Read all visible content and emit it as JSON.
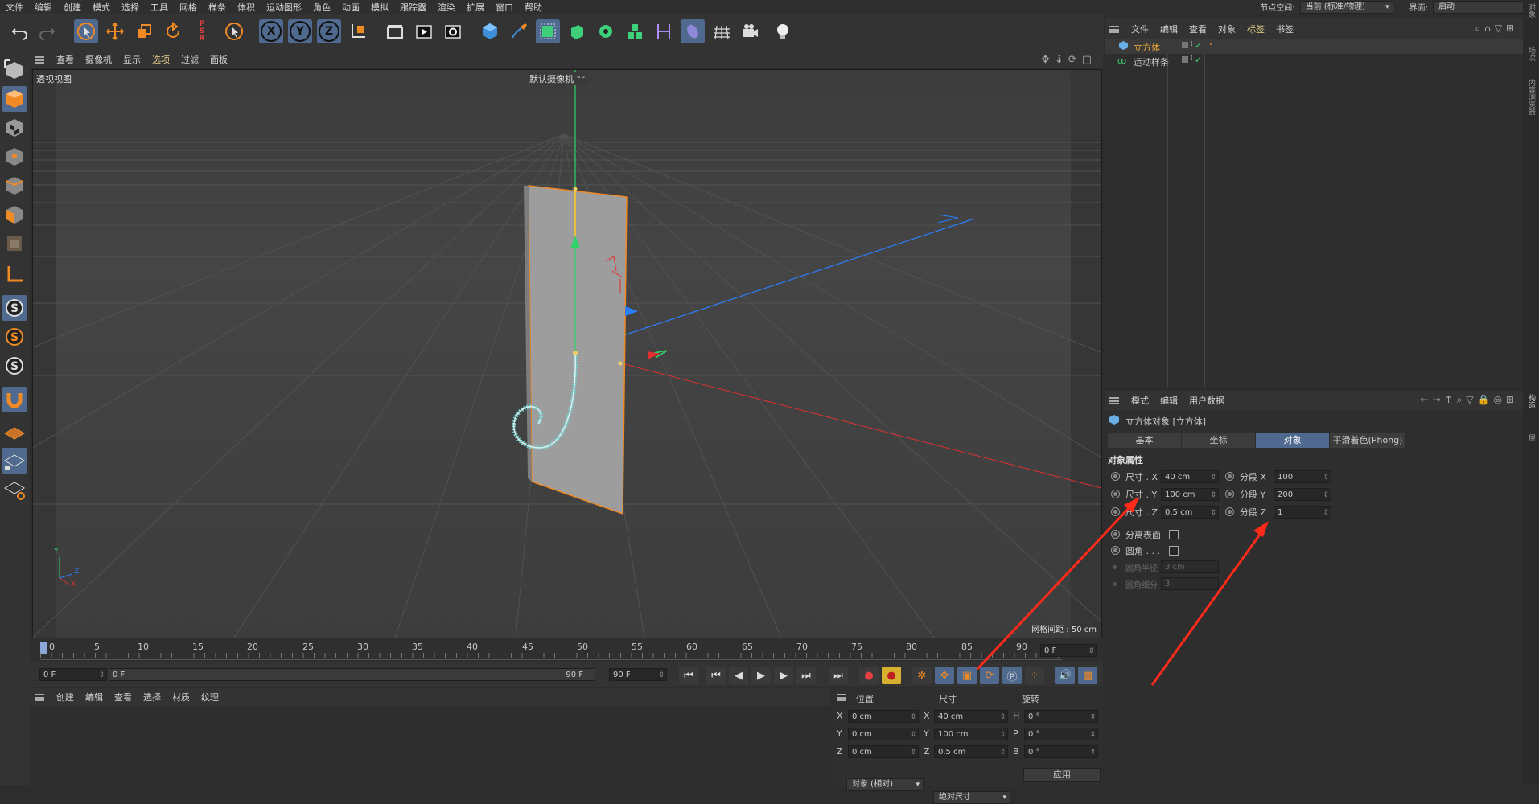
{
  "menubar": {
    "items": [
      "文件",
      "编辑",
      "创建",
      "模式",
      "选择",
      "工具",
      "网格",
      "样条",
      "体积",
      "运动图形",
      "角色",
      "动画",
      "模拟",
      "跟踪器",
      "渲染",
      "扩展",
      "窗口",
      "帮助"
    ],
    "node_space_label": "节点空间:",
    "node_space_value": "当前 (标准/物理)",
    "layout_label": "界面:",
    "layout_value": "启动"
  },
  "viewport": {
    "menu": [
      "查看",
      "摄像机",
      "显示",
      "选项",
      "过滤",
      "面板"
    ],
    "view_name": "透视视图",
    "camera": "默认摄像机",
    "camera_icon": "°°",
    "grid_spacing": "网格间距 : 50 cm",
    "axis_y": "Y",
    "axis_z": "Z",
    "axis_x": "X"
  },
  "timeline": {
    "ticks": [
      "0",
      "5",
      "10",
      "15",
      "20",
      "25",
      "30",
      "35",
      "40",
      "45",
      "50",
      "55",
      "60",
      "65",
      "70",
      "75",
      "80",
      "85",
      "90"
    ],
    "frame_field": "0 F"
  },
  "transport": {
    "start": "0 F",
    "range_start": "0 F",
    "range_end": "90 F",
    "end": "90 F"
  },
  "material": {
    "menu": [
      "创建",
      "编辑",
      "查看",
      "选择",
      "材质",
      "纹理"
    ]
  },
  "coords": {
    "headers": {
      "position": "位置",
      "size": "尺寸",
      "rotation": "旋转"
    },
    "rows": [
      {
        "axis": "X",
        "pos": "0 cm",
        "saxis": "X",
        "size": "40 cm",
        "raxis": "H",
        "rot": "0 °"
      },
      {
        "axis": "Y",
        "pos": "0 cm",
        "saxis": "Y",
        "size": "100 cm",
        "raxis": "P",
        "rot": "0 °"
      },
      {
        "axis": "Z",
        "pos": "0 cm",
        "saxis": "Z",
        "size": "0.5 cm",
        "raxis": "B",
        "rot": "0 °"
      }
    ],
    "mode": "对象 (相对)",
    "size_mode": "绝对尺寸",
    "apply": "应用"
  },
  "objects": {
    "menu": [
      "文件",
      "编辑",
      "查看",
      "对象",
      "标签",
      "书签"
    ],
    "items": [
      {
        "name": "立方体",
        "color": "#e8a93a"
      },
      {
        "name": "运动样条",
        "color": "#c8c8c8"
      }
    ]
  },
  "attributes": {
    "menu": [
      "模式",
      "编辑",
      "用户数据"
    ],
    "title": "立方体对象 [立方体]",
    "tabs": [
      "基本",
      "坐标",
      "对象",
      "平滑着色(Phong)"
    ],
    "selected_tab": "对象",
    "section": "对象属性",
    "rows": [
      {
        "label": "尺寸 . X",
        "value": "40 cm",
        "seg_label": "分段 X",
        "seg_value": "100"
      },
      {
        "label": "尺寸 . Y",
        "value": "100 cm",
        "seg_label": "分段 Y",
        "seg_value": "200"
      },
      {
        "label": "尺寸 . Z",
        "value": "0.5 cm",
        "seg_label": "分段 Z",
        "seg_value": "1"
      }
    ],
    "separate_surfaces": "分离表面",
    "fillet": "圆角 . . .",
    "fillet_radius_label": "圆角半径",
    "fillet_radius": "3 cm",
    "fillet_sub_label": "圆角细分",
    "fillet_sub": "3"
  },
  "right_strip": [
    "对象",
    "场次",
    "内容浏览器",
    "构造",
    "层"
  ],
  "colors": {
    "accent_blue": "#4f6a8e",
    "selection_orange": "#f08a24",
    "arrow_red": "#ff2a1a",
    "axis_green": "#2fd36a",
    "axis_blue": "#2a7fff",
    "axis_red": "#e03030"
  }
}
